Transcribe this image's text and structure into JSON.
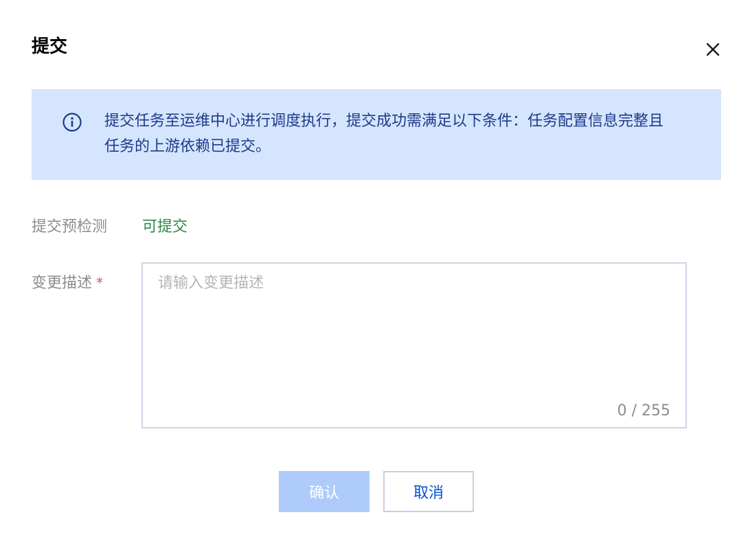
{
  "dialog": {
    "title": "提交",
    "close_icon": "close-icon"
  },
  "notice": {
    "icon": "info-circle-icon",
    "text": "提交任务至运维中心进行调度执行，提交成功需满足以下条件：任务配置信息完整且任务的上游依赖已提交。",
    "background_color": "#d5e5fd",
    "text_color": "#1d3a8a"
  },
  "form": {
    "precheck": {
      "label": "提交预检测",
      "value": "可提交",
      "value_color": "#2e8747"
    },
    "description": {
      "label": "变更描述",
      "required_mark": "*",
      "value": "",
      "placeholder": "请输入变更描述",
      "counter": "0 / 255"
    }
  },
  "actions": {
    "confirm_label": "确认",
    "cancel_label": "取消",
    "confirm_color": "#aecbfb",
    "cancel_text_color": "#0052d9"
  }
}
